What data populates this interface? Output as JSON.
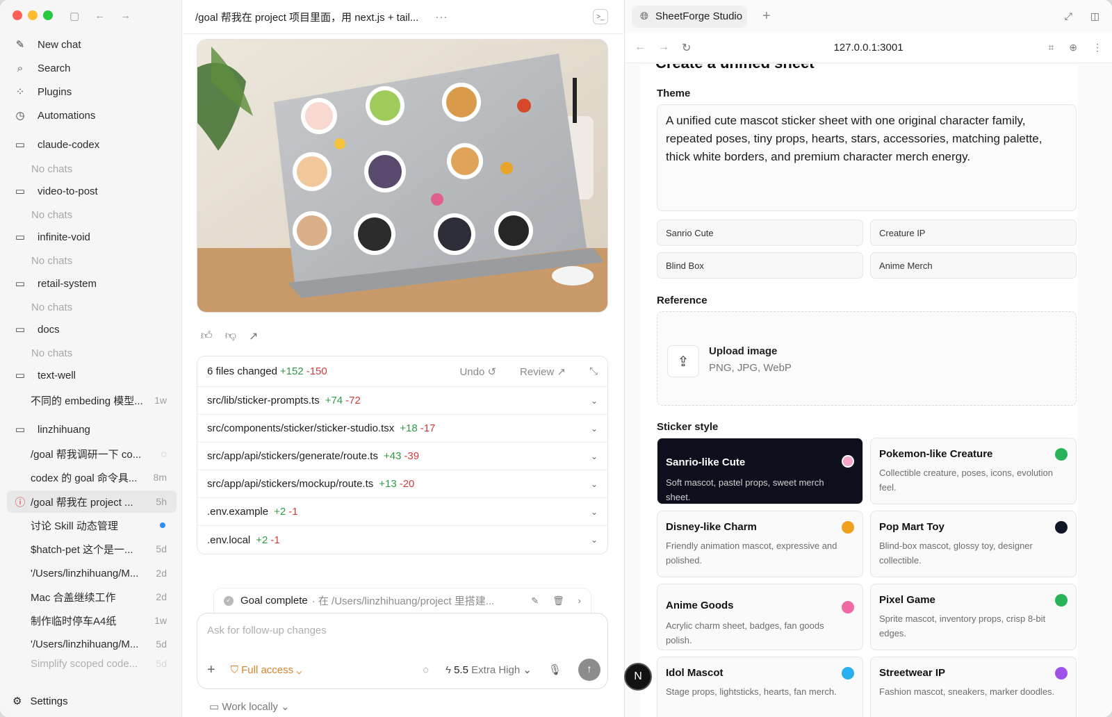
{
  "sidebar": {
    "primary": [
      {
        "label": "New chat",
        "icon": "compose-icon"
      },
      {
        "label": "Search",
        "icon": "search-icon"
      },
      {
        "label": "Plugins",
        "icon": "grid-icon"
      },
      {
        "label": "Automations",
        "icon": "clock-icon"
      }
    ],
    "projects": [
      {
        "label": "claude-codex",
        "empty": "No chats"
      },
      {
        "label": "video-to-post",
        "empty": "No chats"
      },
      {
        "label": "infinite-void",
        "empty": "No chats"
      },
      {
        "label": "retail-system",
        "empty": "No chats"
      },
      {
        "label": "docs",
        "empty": "No chats"
      },
      {
        "label": "text-well",
        "chat": "不同的 embeding 模型...",
        "time": "1w"
      }
    ],
    "linzhihuang": {
      "label": "linzhihuang",
      "chats": [
        {
          "label": "/goal 帮我调研一下 co...",
          "time": ""
        },
        {
          "label": "codex 的 goal 命令具...",
          "time": "8m"
        },
        {
          "label": "/goal 帮我在 project ...",
          "time": "5h"
        },
        {
          "label": "讨论 Skill 动态管理",
          "time": ""
        },
        {
          "label": "$hatch-pet 这个是一...",
          "time": "5d"
        },
        {
          "label": "'/Users/linzhihuang/M...",
          "time": "2d"
        },
        {
          "label": "Mac 合盖继续工作",
          "time": "2d"
        },
        {
          "label": "制作临时停车A4纸",
          "time": "1w"
        },
        {
          "label": "'/Users/linzhihuang/M...",
          "time": "5d"
        },
        {
          "label": "Simplify scoped code...",
          "time": "5d"
        }
      ]
    },
    "settings": "Settings"
  },
  "chat": {
    "title": "/goal 帮我在 project 项目里面，用 next.js + tail...",
    "more": "···",
    "changes": {
      "summary": "6 files changed",
      "added": "+152",
      "removed": "-150",
      "undo": "Undo",
      "review": "Review",
      "files": [
        {
          "path": "src/lib/sticker-prompts.ts",
          "added": "+74",
          "removed": "-72"
        },
        {
          "path": "src/components/sticker/sticker-studio.tsx",
          "added": "+18",
          "removed": "-17"
        },
        {
          "path": "src/app/api/stickers/generate/route.ts",
          "added": "+43",
          "removed": "-39"
        },
        {
          "path": "src/app/api/stickers/mockup/route.ts",
          "added": "+13",
          "removed": "-20"
        },
        {
          "path": ".env.example",
          "added": "+2",
          "removed": "-1"
        },
        {
          "path": ".env.local",
          "added": "+2",
          "removed": "-1"
        }
      ]
    },
    "goal": {
      "label": "Goal complete",
      "detail": "· 在 /Users/linzhihuang/project 里搭建..."
    },
    "composer": {
      "placeholder": "Ask for follow-up changes",
      "access": "Full access",
      "model": "5.5",
      "effort": "Extra High"
    },
    "work_locally": "Work locally"
  },
  "browser": {
    "tab_title": "SheetForge Studio",
    "url": "127.0.0.1:3001",
    "page": {
      "heading": "Create a unified sheet",
      "theme_label": "Theme",
      "theme_text": "A unified cute mascot sticker sheet with one original character family, repeated poses, tiny props, hearts, stars, accessories, matching palette, thick white borders, and premium character merch energy.",
      "chips": [
        "Sanrio Cute",
        "Creature IP",
        "Blind Box",
        "Anime Merch"
      ],
      "reference_label": "Reference",
      "upload_title": "Upload image",
      "upload_types": "PNG, JPG, WebP",
      "style_label": "Sticker style",
      "styles": [
        {
          "title": "Sanrio-like Cute",
          "desc": "Soft mascot, pastel props, sweet merch sheet.",
          "color": "#f2a6c8",
          "selected": true
        },
        {
          "title": "Pokemon-like Creature",
          "desc": "Collectible creature, poses, icons, evolution feel.",
          "color": "#29b35a"
        },
        {
          "title": "Disney-like Charm",
          "desc": "Friendly animation mascot, expressive and polished.",
          "color": "#f0a01e"
        },
        {
          "title": "Pop Mart Toy",
          "desc": "Blind-box mascot, glossy toy, designer collectible.",
          "color": "#0f1628"
        },
        {
          "title": "Anime Goods",
          "desc": "Acrylic charm sheet, badges, fan goods polish.",
          "color": "#f06aa6"
        },
        {
          "title": "Pixel Game",
          "desc": "Sprite mascot, inventory props, crisp 8-bit edges.",
          "color": "#29b35a"
        },
        {
          "title": "Idol Mascot",
          "desc": "Stage props, lightsticks, hearts, fan merch.",
          "color": "#2ab0ee"
        },
        {
          "title": "Streetwear IP",
          "desc": "Fashion mascot, sneakers, marker doodles.",
          "color": "#a052e8"
        }
      ]
    },
    "badge": "N"
  },
  "colors": {
    "close": "#ff5f57",
    "minimize": "#febc2e",
    "zoom": "#28c840",
    "accent_orange": "#d9822b",
    "added": "#2f9a48",
    "removed": "#d23b3b"
  }
}
